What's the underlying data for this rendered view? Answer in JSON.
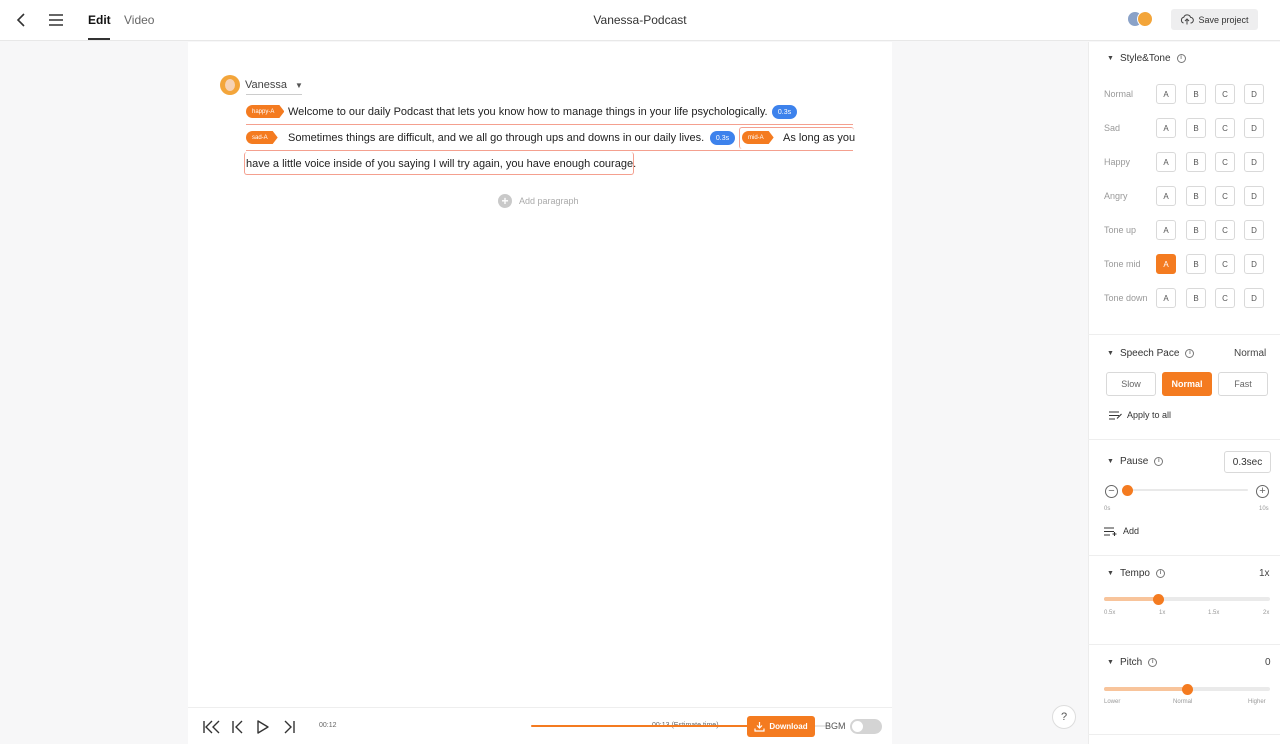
{
  "header": {
    "tabs": [
      {
        "label": "Edit",
        "active": true
      },
      {
        "label": "Video",
        "active": false
      }
    ],
    "title": "Vanessa-Podcast",
    "save_label": "Save project"
  },
  "editor": {
    "speaker": "Vanessa",
    "segments": [
      {
        "tag": "happy-A",
        "text": "Welcome to our daily Podcast that lets you know how to manage things in your life psychologically.",
        "pause": "0.3s"
      },
      {
        "tag": "sad-A",
        "text": "Sometimes things are difficult, and we all go through ups and downs in our daily lives.",
        "pause": "0.3s"
      },
      {
        "tag": "mid-A",
        "text": "As long as you",
        "text_cont": "have a little voice inside of you saying I will try again, you have enough courage."
      }
    ],
    "add_paragraph": "Add paragraph"
  },
  "player": {
    "current_time": "00:12",
    "end_time": "00:13 (Estimate time)",
    "progress": 0.88,
    "download_label": "Download",
    "bgm_label": "BGM",
    "bgm_on": false
  },
  "help_label": "?",
  "panel": {
    "style_tone": {
      "title": "Style&Tone",
      "rows": [
        {
          "label": "Normal",
          "options": [
            "A",
            "B",
            "C",
            "D"
          ],
          "selected": null
        },
        {
          "label": "Sad",
          "options": [
            "A",
            "B",
            "C",
            "D"
          ],
          "selected": null
        },
        {
          "label": "Happy",
          "options": [
            "A",
            "B",
            "C",
            "D"
          ],
          "selected": null
        },
        {
          "label": "Angry",
          "options": [
            "A",
            "B",
            "C",
            "D"
          ],
          "selected": null
        },
        {
          "label": "Tone up",
          "options": [
            "A",
            "B",
            "C",
            "D"
          ],
          "selected": null
        },
        {
          "label": "Tone mid",
          "options": [
            "A",
            "B",
            "C",
            "D"
          ],
          "selected": "A"
        },
        {
          "label": "Tone down",
          "options": [
            "A",
            "B",
            "C",
            "D"
          ],
          "selected": null
        }
      ]
    },
    "speech_pace": {
      "title": "Speech Pace",
      "value": "Normal",
      "options": [
        "Slow",
        "Normal",
        "Fast"
      ],
      "selected": "Normal",
      "apply_label": "Apply to all"
    },
    "pause": {
      "title": "Pause",
      "value": "0.3sec",
      "min_label": "0s",
      "max_label": "10s",
      "level": 0.03,
      "add_label": "Add"
    },
    "tempo": {
      "title": "Tempo",
      "value": "1x",
      "ticks": [
        "0.5x",
        "1x",
        "1.5x",
        "2x"
      ],
      "level": 0.33
    },
    "pitch": {
      "title": "Pitch",
      "value": "0",
      "ticks": [
        "Lower",
        "Normal",
        "Higher"
      ],
      "level": 0.5
    }
  },
  "colors": {
    "accent": "#f47b20",
    "pause_badge": "#3d82ec"
  }
}
